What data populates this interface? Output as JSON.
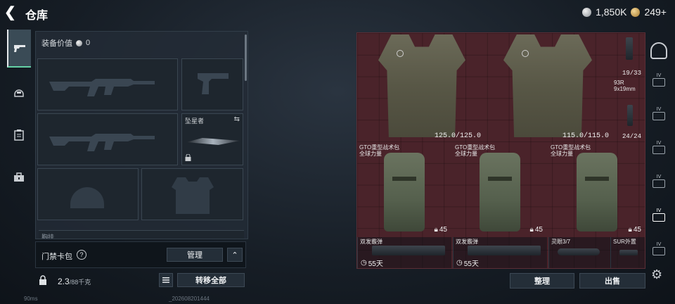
{
  "header": {
    "title": "仓库",
    "silver": "1,850K",
    "gold": "249+"
  },
  "rail": {
    "items": [
      "pistol-icon",
      "helmet-icon",
      "clipboard-icon",
      "toolbox-icon"
    ]
  },
  "loadout": {
    "value_label": "装备价值",
    "value": "0",
    "melee_label": "坠星者",
    "partial_label": "胸挂"
  },
  "keycard": {
    "label": "门禁卡包",
    "help": "?",
    "manage_label": "管理",
    "collapse": "⌃"
  },
  "weight": {
    "current": "2.3",
    "max": "/88千克",
    "transfer_label": "转移全部"
  },
  "stash": {
    "vest1_durability": "125.0/125.0",
    "vest2_durability": "115.0/115.0",
    "ammo1_count": "19/33",
    "ammo2_name": "93R\n9x19mm",
    "ammo2_count": "24/24",
    "pack_name_1": "GTO重型战术包",
    "pack_sub_1": "全球力量",
    "pack_name_2": "GTO重型战术包",
    "pack_sub_2": "全球力量",
    "pack_name_3": "GTO重型战术包",
    "pack_sub_3": "全球力量",
    "pack_count_1": "45",
    "pack_count_2": "45",
    "pack_count_3": "45",
    "gun1_name": "双发霰弹",
    "gun1_timer": "55天",
    "gun2_name": "双发霰弹",
    "gun2_timer": "55天",
    "scope_name": "灵眼3/7",
    "sight_name": "SUR外置"
  },
  "actions": {
    "sort_label": "整理",
    "sell_label": "出售"
  },
  "footer": {
    "ping": "90ms",
    "build": "_202608201444"
  },
  "right_rail": {
    "items": [
      "IV",
      "IV",
      "IV",
      "IV",
      "IV",
      "IV",
      "IV"
    ]
  }
}
